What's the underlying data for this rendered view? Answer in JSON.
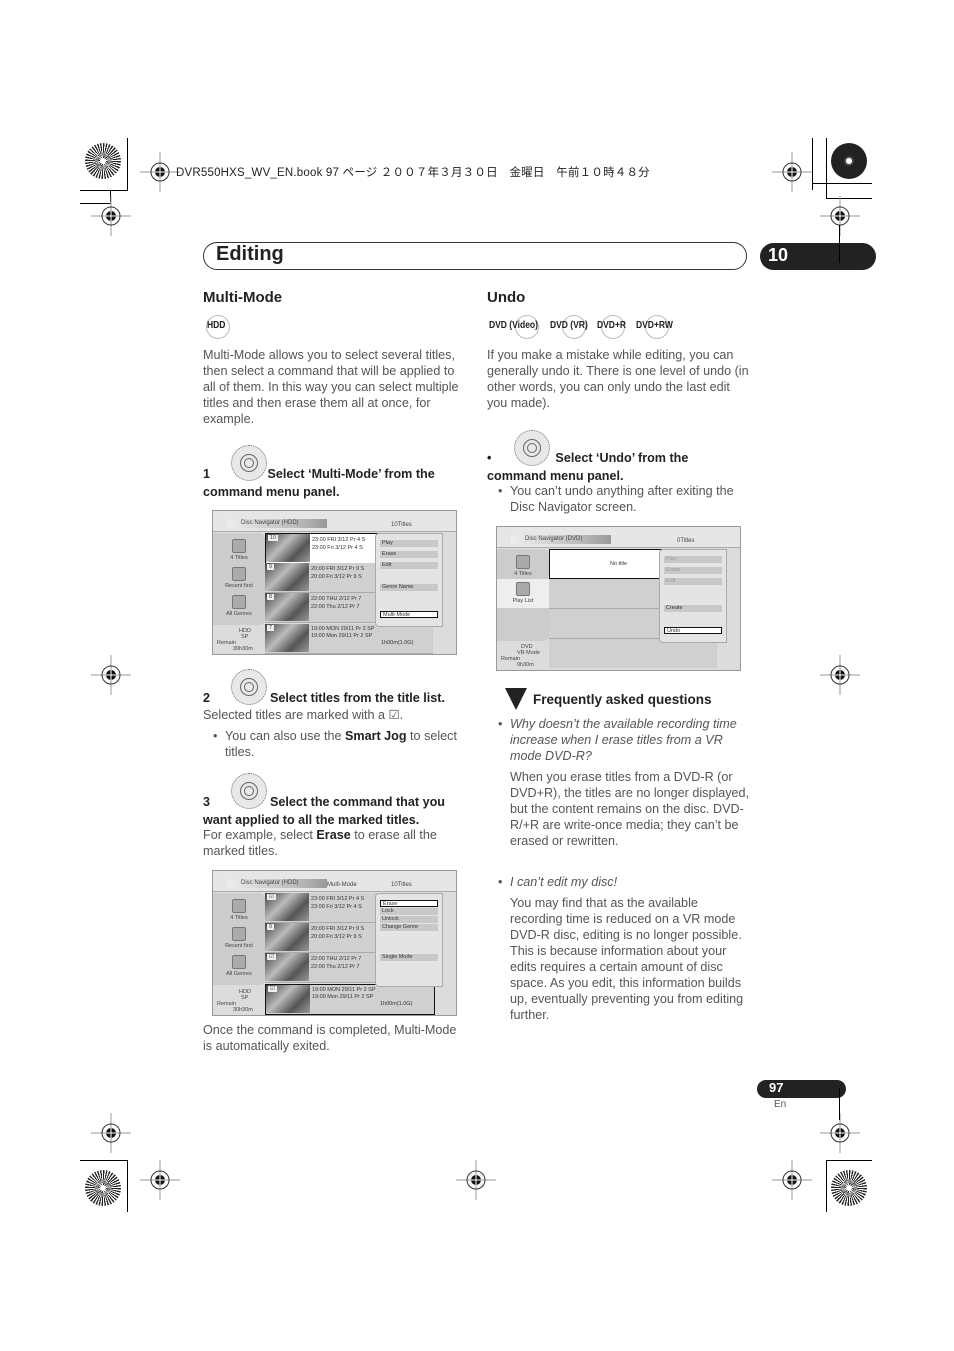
{
  "print_header": {
    "book_line": "DVR550HXS_WV_EN.book  97 ページ  ２００７年３月３０日　金曜日　午前１０時４８分"
  },
  "chapter": {
    "title": "Editing",
    "number": "10"
  },
  "multi_mode": {
    "heading": "Multi-Mode",
    "badges": [
      "HDD"
    ],
    "intro": "Multi-Mode allows you to select several titles, then select a command that will be applied to all of them. In this way you can select multiple titles and then erase them all at once, for example.",
    "steps": [
      {
        "num": "1",
        "title": "Select ‘Multi-Mode’ from the command menu panel."
      },
      {
        "num": "2",
        "title": "Select titles from the title list.",
        "text": "Selected titles are marked with a ☑.",
        "bullet_pre": "You can also use the ",
        "bullet_bold": "Smart Jog",
        "bullet_post": " to select titles."
      },
      {
        "num": "3",
        "title": "Select the command that you want applied to all the marked titles.",
        "text_pre": "For example, select ",
        "text_bold": "Erase",
        "text_post": " to erase all the marked titles."
      }
    ],
    "outro": "Once the command is completed, Multi-Mode is automatically exited."
  },
  "screen1": {
    "tab": "Disc Navigator (HDD)",
    "count": "10Titles",
    "side": [
      "4 Titles",
      "Recent first",
      "All Genres"
    ],
    "device": [
      "HDD",
      "SP"
    ],
    "remain": [
      "Remain",
      "30h30m"
    ],
    "rows": [
      {
        "num": "10",
        "l1": "23:00 FRI  3/12  Pr 4  S",
        "l2": "23:00  Fri  3/12  Pr 4  S"
      },
      {
        "num": "9",
        "l1": "20:00  FRI  3/12  Pr 9  S",
        "l2": "20:00  Fri  3/12  Pr 9  S"
      },
      {
        "num": "8",
        "l1": "22:00  THU  2/12  Pr 7",
        "l2": "22:00  Thu  2/12  Pr 7"
      },
      {
        "num": "7",
        "l1": "19:00  MON  29/11  Pr 2  SP",
        "l2": "19:00  Mon  29/11  Pr 2  SP",
        "l3": "1h00m(1.0G)"
      }
    ],
    "menu": [
      "Play",
      "Erase",
      "Edit",
      "Genre Name",
      "Multi-Mode"
    ]
  },
  "screen2": {
    "tab": "Disc Navigator (HDD)",
    "mode": "Multi-Mode",
    "count": "10Titles",
    "side": [
      "4 Titles",
      "Recent first",
      "All Genres"
    ],
    "device": [
      "HDD",
      "SP"
    ],
    "remain": [
      "Remain",
      "30h30m"
    ],
    "rows": [
      {
        "num": "☑",
        "l1": "23:00 FRI  3/12  Pr 4  S",
        "l2": "23:00  Fri  3/12  Pr 4  S"
      },
      {
        "num": "9",
        "l1": "20:00  FRI  3/12  Pr 9  S",
        "l2": "20:00  Fri  3/12  Pr 9  S"
      },
      {
        "num": "☑",
        "l1": "22:00  THU  2/12  Pr 7",
        "l2": "22:00  Thu  2/12  Pr 7"
      },
      {
        "num": "☑",
        "l1": "19:00  MON  29/11  Pr 2  SP",
        "l2": "19:00  Mon  29/11  Pr 2  SP",
        "l3": "1h00m(1.0G)"
      }
    ],
    "menu": [
      "Erase",
      "Lock",
      "Unlock",
      "Change Genre",
      "Single Mode"
    ]
  },
  "undo": {
    "heading": "Undo",
    "badges": [
      "DVD (Video)",
      "DVD (VR)",
      "DVD+R",
      "DVD+RW"
    ],
    "intro": "If you make a mistake while editing, you can generally undo it. There is one level of undo (in other words, you can only undo the last edit you made).",
    "step": {
      "num": "•",
      "title": "Select ‘Undo’ from the command menu panel."
    },
    "bullet": "You can’t undo anything after exiting the Disc Navigator screen."
  },
  "screen3": {
    "tab": "Disc Navigator (DVD)",
    "count": "0Titles",
    "side": [
      "4 Titles",
      "Play List"
    ],
    "no_title": "No title",
    "device": [
      "DVD",
      "VR Mode"
    ],
    "remain": [
      "Remain",
      "0h30m"
    ],
    "menu": [
      "Play",
      "Erase",
      "Edit",
      "Create",
      "Undo"
    ]
  },
  "faq": {
    "title": "Frequently asked questions",
    "items": [
      {
        "q": "Why doesn’t the available recording time increase when I erase titles from a VR mode DVD-R?",
        "a": "When you erase titles from a DVD-R (or DVD+R), the titles are no longer displayed, but the content remains on the disc. DVD-R/+R are write-once media; they can’t be erased or rewritten."
      },
      {
        "q": "I can’t edit my disc!",
        "a": "You may find that as the available recording time is reduced on a VR mode DVD-R disc, editing is no longer possible. This is because information about your edits requires a certain amount of disc space. As you edit, this information builds up, eventually preventing you from editing further."
      }
    ]
  },
  "footer": {
    "page": "97",
    "lang": "En"
  }
}
